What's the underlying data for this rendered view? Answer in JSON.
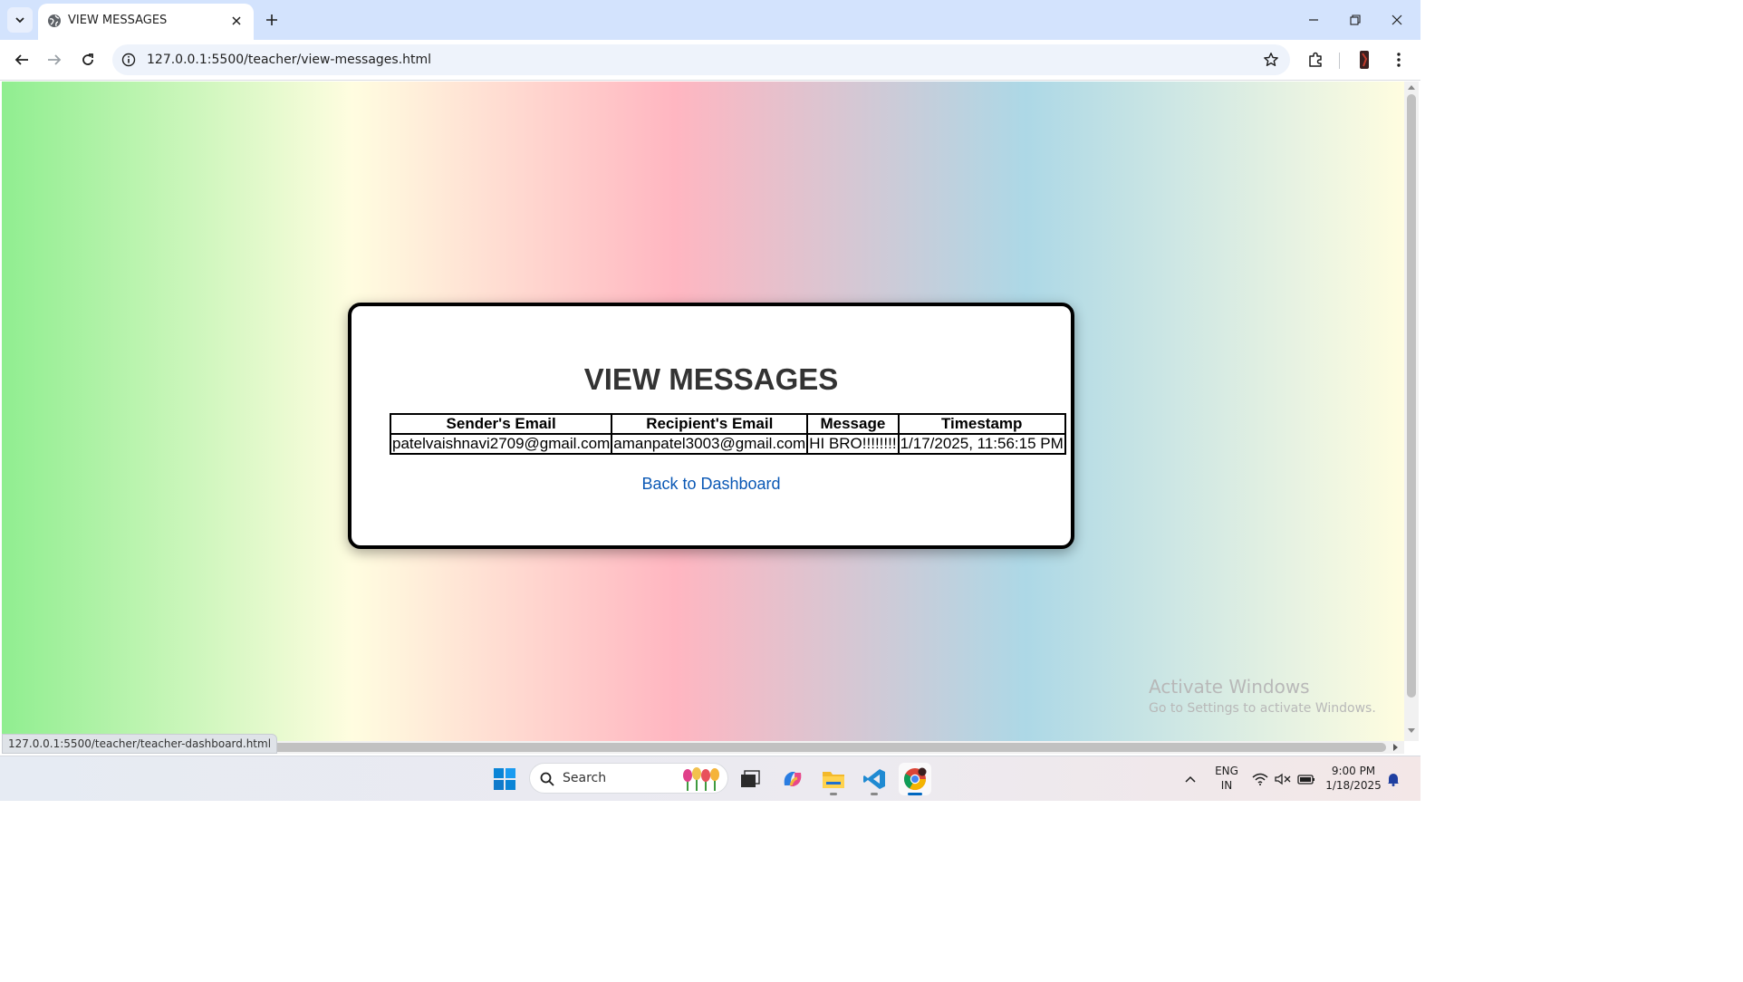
{
  "browser": {
    "tab_title": "VIEW MESSAGES",
    "url": "127.0.0.1:5500/teacher/view-messages.html",
    "status_url": "127.0.0.1:5500/teacher/teacher-dashboard.html"
  },
  "page": {
    "heading": "VIEW MESSAGES",
    "table": {
      "headers": [
        "Sender's Email",
        "Recipient's Email",
        "Message",
        "Timestamp"
      ],
      "rows": [
        [
          "patelvaishnavi2709@gmail.com",
          "amanpatel3003@gmail.com",
          "HI BRO!!!!!!!!",
          "1/17/2025, 11:56:15 PM"
        ]
      ]
    },
    "back_link": "Back to Dashboard"
  },
  "watermark": {
    "title": "Activate Windows",
    "subtitle": "Go to Settings to activate Windows."
  },
  "taskbar": {
    "search_label": "Search",
    "lang_line1": "ENG",
    "lang_line2": "IN",
    "time": "9:00 PM",
    "date": "1/18/2025"
  }
}
